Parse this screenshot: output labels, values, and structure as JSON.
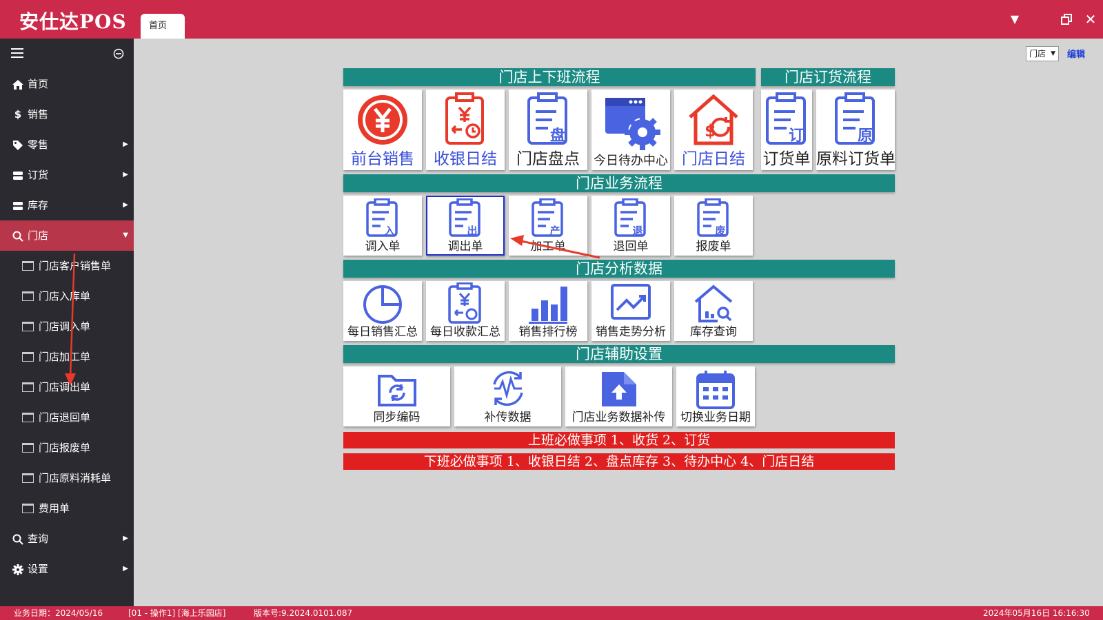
{
  "app": {
    "title": "安仕达POS",
    "tab_home": "首页"
  },
  "window": {
    "minimize_icon": "triangle-down",
    "restore_icon": "restore",
    "close_icon": "close"
  },
  "sidebar": {
    "items": [
      {
        "label": "首页",
        "icon": "home-icon"
      },
      {
        "label": "销售",
        "icon": "dollar-icon"
      },
      {
        "label": "零售",
        "icon": "tag-icon"
      },
      {
        "label": "订货",
        "icon": "stack-icon"
      },
      {
        "label": "库存",
        "icon": "stack-icon"
      },
      {
        "label": "门店",
        "icon": "search-icon"
      }
    ],
    "store_sub": [
      "门店客户销售单",
      "门店入库单",
      "门店调入单",
      "门店加工单",
      "门店调出单",
      "门店退回单",
      "门店报废单",
      "门店原料消耗单",
      "费用单"
    ],
    "bottom": [
      {
        "label": "查询",
        "icon": "search-icon"
      },
      {
        "label": "设置",
        "icon": "gear-icon"
      }
    ]
  },
  "main": {
    "store_select": "门店",
    "edit_link": "编辑",
    "sections": {
      "shift": "门店上下班流程",
      "order": "门店订货流程",
      "business": "门店业务流程",
      "analysis": "门店分析数据",
      "aux": "门店辅助设置"
    },
    "shift_tiles": [
      "前台销售",
      "收银日结",
      "门店盘点",
      "今日待办中心",
      "门店日结"
    ],
    "order_tiles": [
      "订货单",
      "原料订货单"
    ],
    "business_tiles": [
      "调入单",
      "调出单",
      "加工单",
      "退回单",
      "报废单"
    ],
    "business_badges": [
      "入",
      "出",
      "产",
      "退",
      "废"
    ],
    "analysis_tiles": [
      "每日销售汇总",
      "每日收款汇总",
      "销售排行榜",
      "销售走势分析",
      "库存查询"
    ],
    "aux_tiles": [
      "同步编码",
      "补传数据",
      "门店业务数据补传",
      "切换业务日期"
    ],
    "shift_badges": {
      "count": "盘",
      "order": "订",
      "raw": "原"
    },
    "banners": [
      "上班必做事项 1、收货 2、订货",
      "下班必做事项 1、收银日结 2、盘点库存 3、待办中心 4、门店日结"
    ]
  },
  "status": {
    "biz_date": "业务日期：2024/05/16",
    "operator": "[01 - 操作1]  [海上乐园店]",
    "version": "版本号:9.2024.0101.087",
    "datetime": "2024年05月16日 16:16:30"
  },
  "colors": {
    "brand_red": "#cc2a4a",
    "section_teal": "#1a8a82",
    "icon_red": "#e8392a",
    "icon_blue": "#4a63e0",
    "banner_red": "#e02020"
  }
}
